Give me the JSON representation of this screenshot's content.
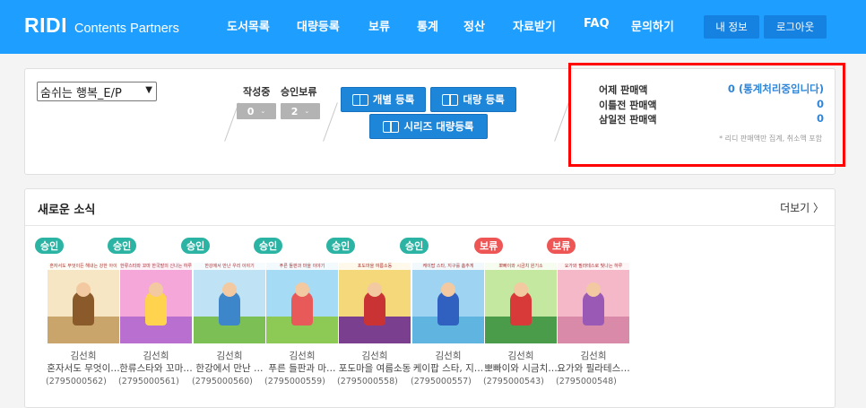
{
  "header": {
    "logo_main": "RIDI",
    "logo_sub": "Contents Partners",
    "nav": [
      "도서목록",
      "대량등록",
      "보류",
      "통계",
      "정산",
      "자료받기",
      "FAQ",
      "문의하기"
    ],
    "my_info": "내 정보",
    "logout": "로그아웃"
  },
  "panel": {
    "book_select": "숨쉬는 행복_E/P",
    "writing_label": "작성중",
    "writing_count": "0",
    "approval_hold_label": "승인보류",
    "approval_hold_count": "2",
    "individual_register": "개별 등록",
    "bulk_register": "대량 등록",
    "series_bulk_register": "시리즈 대량등록"
  },
  "sales": {
    "yesterday_label": "어제 판매액",
    "yesterday_value": "0 (통계처리중입니다)",
    "two_days_label": "이틀전 판매액",
    "two_days_value": "0",
    "three_days_label": "삼일전 판매액",
    "three_days_value": "0",
    "note": "* 리디 판매액만 집계, 취소액 포함"
  },
  "news": {
    "title": "새로운 소식",
    "more": "더보기 〉",
    "books": [
      {
        "status": "승인",
        "status_type": "approved",
        "author": "김선희",
        "title": "혼자서도 무엇이…",
        "id": "(2795000562)",
        "cover_strip": "혼자서도 무엇이든 해내는 강한 아이",
        "sky": "#f7e6c4",
        "ground": "#c9a56b",
        "fig": "#8b5a2b"
      },
      {
        "status": "승인",
        "status_type": "approved",
        "author": "김선희",
        "title": "한류스타와 꼬마…",
        "id": "(2795000561)",
        "cover_strip": "한류스타와 꼬마 한국말의 신나는 하루",
        "sky": "#f4a7d8",
        "ground": "#b86fd0",
        "fig": "#ffd34d"
      },
      {
        "status": "승인",
        "status_type": "approved",
        "author": "김선희",
        "title": "한강에서 만난 …",
        "id": "(2795000560)",
        "cover_strip": "한강에서 만난 우리 이야기",
        "sky": "#bfe3f5",
        "ground": "#7cbf55",
        "fig": "#3d86c9"
      },
      {
        "status": "승인",
        "status_type": "approved",
        "author": "김선희",
        "title": "푸른 들판과 마…",
        "id": "(2795000559)",
        "cover_strip": "푸른 들판과 마을 이야기",
        "sky": "#a6dbf5",
        "ground": "#8cc955",
        "fig": "#e85a5a"
      },
      {
        "status": "승인",
        "status_type": "approved",
        "author": "김선희",
        "title": "포도마을 여름소동",
        "id": "(2795000558)",
        "cover_strip": "포도마을 여름소동",
        "sky": "#f5d879",
        "ground": "#7a3f8f",
        "fig": "#c93333"
      },
      {
        "status": "승인",
        "status_type": "approved",
        "author": "김선희",
        "title": "케이팝 스타, 지…",
        "id": "(2795000557)",
        "cover_strip": "케이팝 스타, 지구를 춤추게",
        "sky": "#9fd3f2",
        "ground": "#5fb4e0",
        "fig": "#3060c0"
      },
      {
        "status": "보류",
        "status_type": "hold",
        "author": "김선희",
        "title": "뽀빠이와 시금치…",
        "id": "(2795000543)",
        "cover_strip": "뽀빠이와 시금치 원기소",
        "sky": "#c5e8a0",
        "ground": "#4a9c4a",
        "fig": "#d83a3a"
      },
      {
        "status": "보류",
        "status_type": "hold",
        "author": "김선희",
        "title": "요가와 필라테스…",
        "id": "(2795000548)",
        "cover_strip": "요가와 필라테스로 빛나는 하루",
        "sky": "#f5b8c8",
        "ground": "#d98aa8",
        "fig": "#9b59b6"
      }
    ]
  }
}
